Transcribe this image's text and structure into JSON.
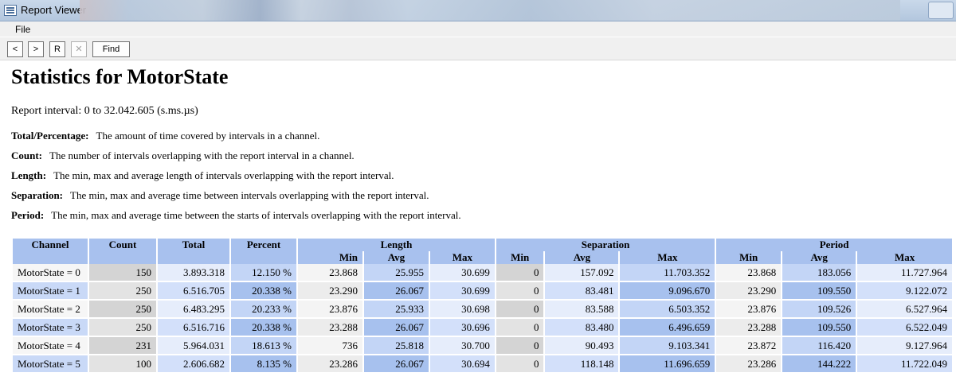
{
  "window": {
    "title": "Report Viewer"
  },
  "menu": {
    "file": "File"
  },
  "toolbar": {
    "back": "<",
    "forward": ">",
    "refresh": "R",
    "stop": "✕",
    "find": "Find"
  },
  "report": {
    "heading": "Statistics for MotorState",
    "interval": "Report interval: 0 to 32.042.605 (s.ms.µs)",
    "definitions": [
      {
        "term": "Total/Percentage:",
        "text": "The amount of time covered by intervals in a channel."
      },
      {
        "term": "Count:",
        "text": "The number of intervals overlapping with the report interval in a channel."
      },
      {
        "term": "Length:",
        "text": "The min, max and average length of intervals overlapping with the report interval."
      },
      {
        "term": "Separation:",
        "text": "The min, max and average time between intervals overlapping with the report interval."
      },
      {
        "term": "Period:",
        "text": "The min, max and average time between the starts of intervals overlapping with the report interval."
      }
    ]
  },
  "table": {
    "headers": {
      "channel": "Channel",
      "count": "Count",
      "total": "Total",
      "percent": "Percent",
      "length": "Length",
      "separation": "Separation",
      "period": "Period"
    },
    "subheaders": {
      "min": "Min",
      "avg": "Avg",
      "max": "Max"
    },
    "rows": [
      [
        "MotorState = 0",
        "150",
        "3.893.318",
        "12.150 %",
        "23.868",
        "25.955",
        "30.699",
        "0",
        "157.092",
        "11.703.352",
        "23.868",
        "183.056",
        "11.727.964"
      ],
      [
        "MotorState = 1",
        "250",
        "6.516.705",
        "20.338 %",
        "23.290",
        "26.067",
        "30.699",
        "0",
        "83.481",
        "9.096.670",
        "23.290",
        "109.550",
        "9.122.072"
      ],
      [
        "MotorState = 2",
        "250",
        "6.483.295",
        "20.233 %",
        "23.876",
        "25.933",
        "30.698",
        "0",
        "83.588",
        "6.503.352",
        "23.876",
        "109.526",
        "6.527.964"
      ],
      [
        "MotorState = 3",
        "250",
        "6.516.716",
        "20.338 %",
        "23.288",
        "26.067",
        "30.696",
        "0",
        "83.480",
        "6.496.659",
        "23.288",
        "109.550",
        "6.522.049"
      ],
      [
        "MotorState = 4",
        "231",
        "5.964.031",
        "18.613 %",
        "736",
        "25.818",
        "30.700",
        "0",
        "90.493",
        "9.103.341",
        "23.872",
        "116.420",
        "9.127.964"
      ],
      [
        "MotorState = 5",
        "100",
        "2.606.682",
        "8.135 %",
        "23.286",
        "26.067",
        "30.694",
        "0",
        "118.148",
        "11.696.659",
        "23.286",
        "144.222",
        "11.722.049"
      ]
    ]
  }
}
